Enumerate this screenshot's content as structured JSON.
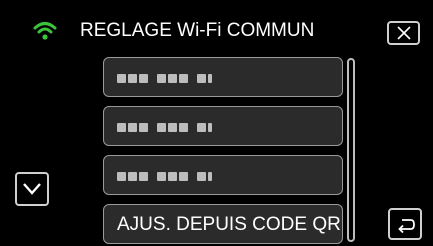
{
  "header": {
    "title": "REGLAGE Wi-Fi COMMUN",
    "wifi_icon": "wifi-icon",
    "close_icon": "close-icon"
  },
  "list": {
    "items": [
      {
        "label": "",
        "masked": true
      },
      {
        "label": "",
        "masked": true
      },
      {
        "label": "",
        "masked": true
      },
      {
        "label": "AJUS. DEPUIS CODE QR",
        "masked": false
      }
    ]
  },
  "controls": {
    "scroll_down_icon": "chevron-down-icon",
    "back_icon": "back-arrow-icon"
  },
  "colors": {
    "background": "#000000",
    "wifi": "#3cc23c",
    "item_bg": "#2b2b2b",
    "item_border": "#9a9a9a",
    "text": "#ffffff"
  }
}
